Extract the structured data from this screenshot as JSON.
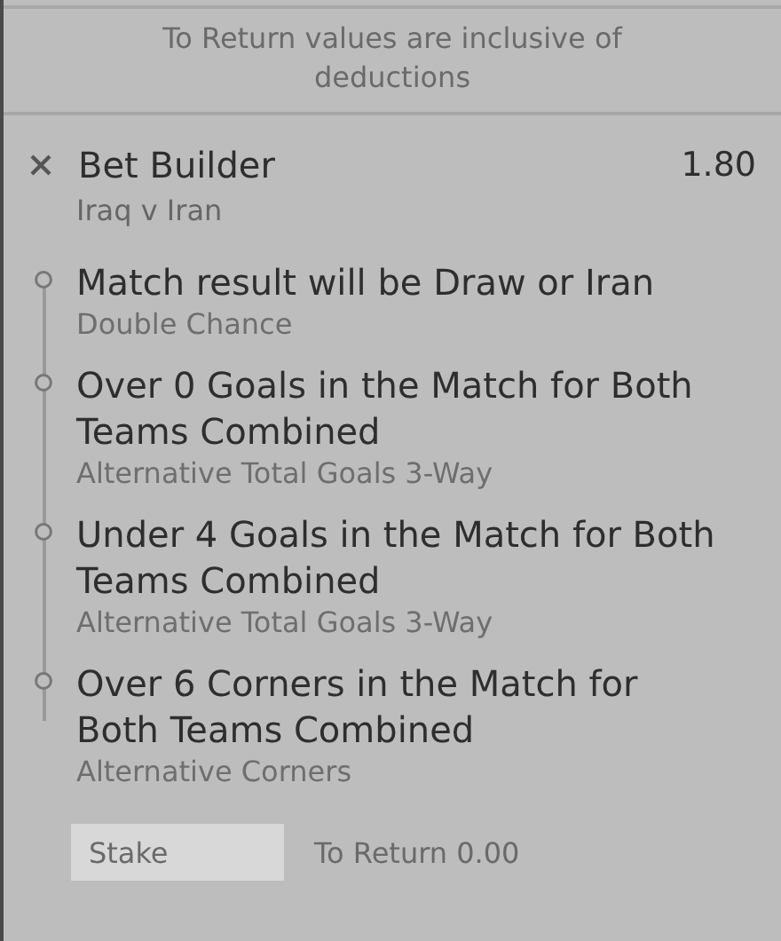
{
  "notice": "To Return values are inclusive of deductions",
  "bet": {
    "title": "Bet Builder",
    "odds": "1.80",
    "fixture": "Iraq v Iran"
  },
  "selections": [
    {
      "name": "Match result will be Draw or Iran",
      "market": "Double Chance"
    },
    {
      "name": "Over 0 Goals in the Match for Both Teams Combined",
      "market": "Alternative Total Goals 3-Way"
    },
    {
      "name": "Under 4 Goals in the Match for Both Teams Combined",
      "market": "Alternative Total Goals 3-Way"
    },
    {
      "name": "Over 6 Corners in the Match for Both Teams Combined",
      "market": "Alternative Corners"
    }
  ],
  "stake": {
    "placeholder": "Stake"
  },
  "to_return": "To Return 0.00"
}
